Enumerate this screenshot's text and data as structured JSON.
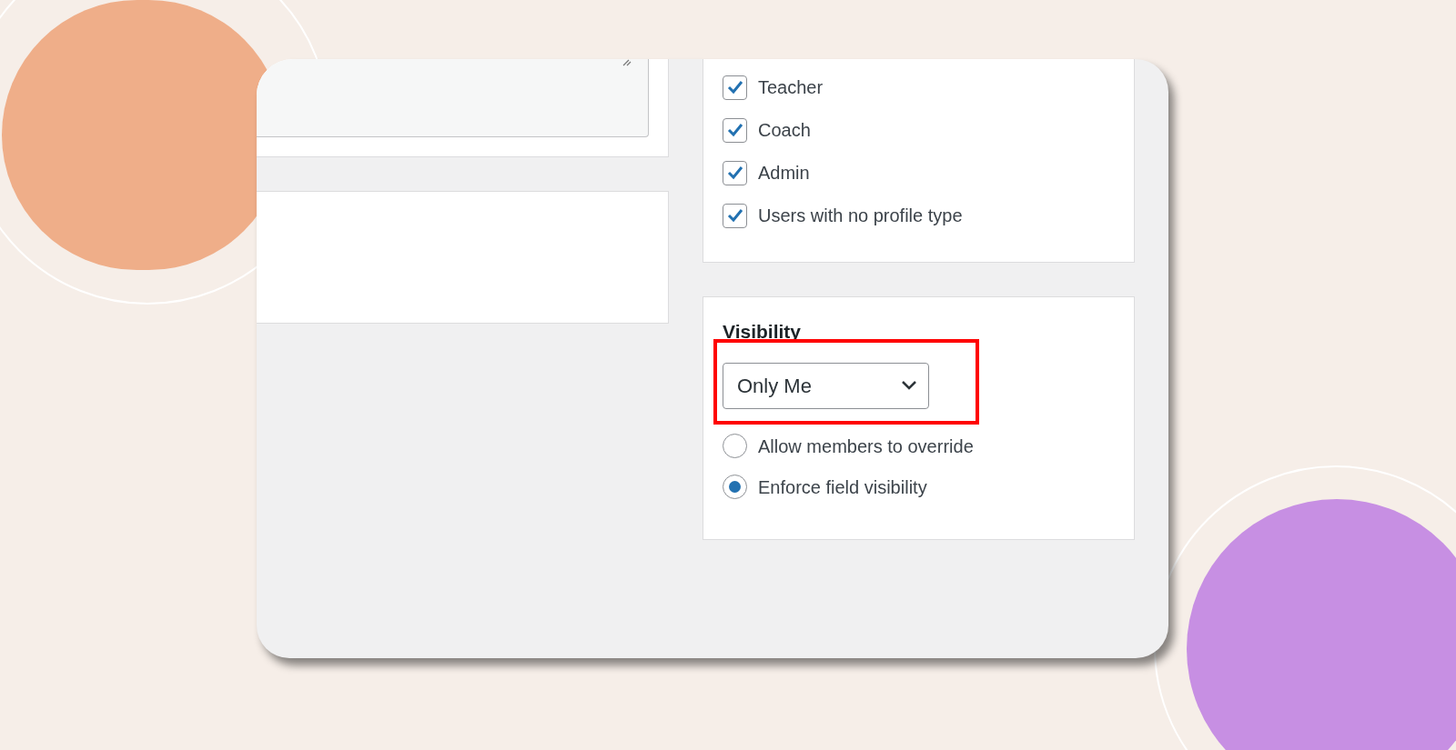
{
  "profile_types": [
    {
      "label": "Teacher",
      "checked": true
    },
    {
      "label": "Coach",
      "checked": true
    },
    {
      "label": "Admin",
      "checked": true
    },
    {
      "label": "Users with no profile type",
      "checked": true
    }
  ],
  "visibility": {
    "title": "Visibility",
    "value": "Only Me",
    "highlighted": true,
    "options": [
      {
        "label": "Allow members to override",
        "selected": false
      },
      {
        "label": "Enforce field visibility",
        "selected": true
      }
    ]
  }
}
